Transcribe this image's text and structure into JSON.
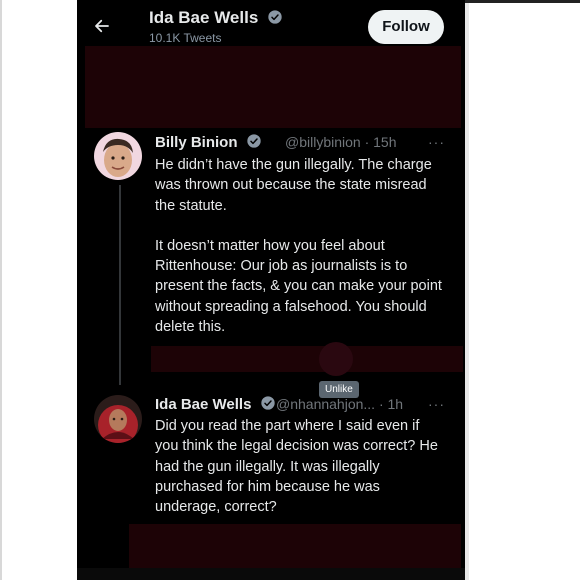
{
  "header": {
    "name": "Ida Bae Wells",
    "tweet_count": "10.1K Tweets",
    "follow_label": "Follow",
    "icon": "back-arrow-icon"
  },
  "tweets": [
    {
      "name": "Billy Binion",
      "handle": "@billybinion",
      "time": "· 15h",
      "more": "···",
      "paragraphs": [
        "He didn’t have the gun illegally. The charge was thrown out because the state misread the statute.",
        "It doesn’t matter how you feel about Rittenhouse: Our job as journalists is to present the facts, & you can make your point without spreading a falsehood. You should delete this."
      ]
    },
    {
      "name": "Ida Bae Wells",
      "handle": "@nhannahjon...",
      "time": "· 1h",
      "more": "···",
      "paragraphs": [
        "Did you read the part where I said even if you think the legal decision was correct? He had the gun illegally. It was illegally purchased for him because he was underage, correct?"
      ]
    }
  ],
  "tooltip": "Unlike",
  "colors": {
    "background": "#000000",
    "verified": "#8b98a5",
    "redaction": "#1d0306"
  }
}
